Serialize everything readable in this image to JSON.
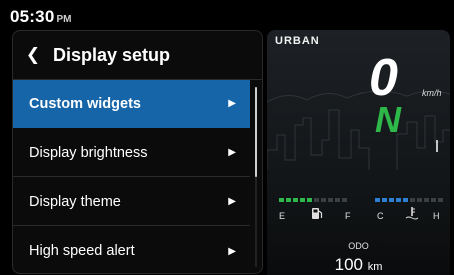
{
  "status": {
    "time": "05:30",
    "ampm": "PM"
  },
  "menu": {
    "back_icon": "chevron-left",
    "title": "Display setup",
    "items": [
      {
        "label": "Custom widgets",
        "active": true
      },
      {
        "label": "Display brightness",
        "active": false
      },
      {
        "label": "Display theme",
        "active": false
      },
      {
        "label": "High speed alert",
        "active": false
      }
    ]
  },
  "cluster": {
    "mode": "URBAN",
    "speed": "0",
    "speed_unit": "km/h",
    "gear": "N",
    "fuel": {
      "low": "E",
      "high": "F",
      "icon": "fuel-pump-icon",
      "level": 0.5
    },
    "temp": {
      "low": "C",
      "high": "H",
      "icon": "coolant-temperature-icon",
      "level": 0.5
    },
    "odo_label": "ODO",
    "odo_value": "100",
    "odo_unit": "km"
  },
  "colors": {
    "accent": "#1565a8",
    "gear_green": "#2fb84a",
    "fuel_green": "#2fb84a",
    "temp_blue": "#2f7fd1"
  }
}
